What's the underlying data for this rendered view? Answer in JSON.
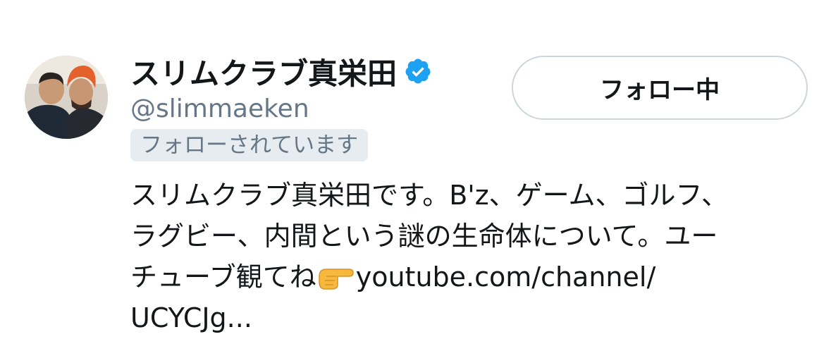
{
  "profile": {
    "display_name": "スリムクラブ真栄田",
    "handle": "@slimmaeken",
    "follows_you": "フォローされています",
    "verified": true
  },
  "actions": {
    "follow_button_label": "フォロー中"
  },
  "bio": {
    "line1": "スリムクラブ真栄田です。B'z、ゲーム、ゴルフ、",
    "line2": "ラグビー、内間という謎の生命体について。ユー",
    "line3_text": "チューブ観てね",
    "emoji": "pointing-right-emoji",
    "line3_link": "youtube.com/channel/",
    "line4_link": "UCYCJg..."
  },
  "colors": {
    "text_primary": "#14171a",
    "text_secondary": "#657786",
    "badge_bg": "#e6ecf0",
    "button_border": "#ccd6dd",
    "verified_blue": "#1da1f2"
  }
}
